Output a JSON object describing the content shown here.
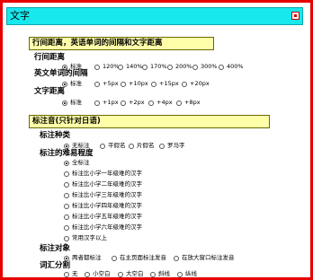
{
  "window": {
    "title": "文字"
  },
  "sections": {
    "spacing": {
      "heading": "行间距离，英语单词的间隔和文字距离",
      "line_spacing": {
        "label": "行间距离",
        "options": [
          "标准",
          "120%",
          "140%",
          "170%",
          "200%",
          "300%",
          "400%"
        ],
        "selected": 0
      },
      "word_spacing": {
        "label": "英文单词的间隔",
        "options": [
          "标准",
          "+5px",
          "+10px",
          "+15px",
          "+20px"
        ],
        "selected": 0
      },
      "char_spacing": {
        "label": "文字距离",
        "options": [
          "标准",
          "+1px",
          "+2px",
          "+4px",
          "+8px"
        ],
        "selected": 0
      }
    },
    "ruby": {
      "heading": "标注音(只针对日语)",
      "type": {
        "label": "标注种类",
        "options": [
          "无标注",
          "平假名",
          "片假名",
          "罗马字"
        ],
        "selected": 0
      },
      "difficulty": {
        "label": "标注的难易程度",
        "options": [
          "全标注",
          "标注比小学一年级难的汉字",
          "标注比小学二年级难的汉字",
          "标注比小学三年级难的汉字",
          "标注比小学四年级难的汉字",
          "标注比小学五年级难的汉字",
          "标注比小学六年级难的汉字",
          "常用汉字以上"
        ],
        "selected": 0
      },
      "target": {
        "label": "标注对象",
        "options": [
          "两者都标注",
          "在主页面标注发音",
          "在放大窗口标注发音"
        ],
        "selected": 0
      },
      "segmentation": {
        "label": "词汇分割",
        "options": [
          "无",
          "小空白",
          "大空白",
          "斜线",
          "纵线"
        ],
        "selected": 0
      }
    }
  }
}
